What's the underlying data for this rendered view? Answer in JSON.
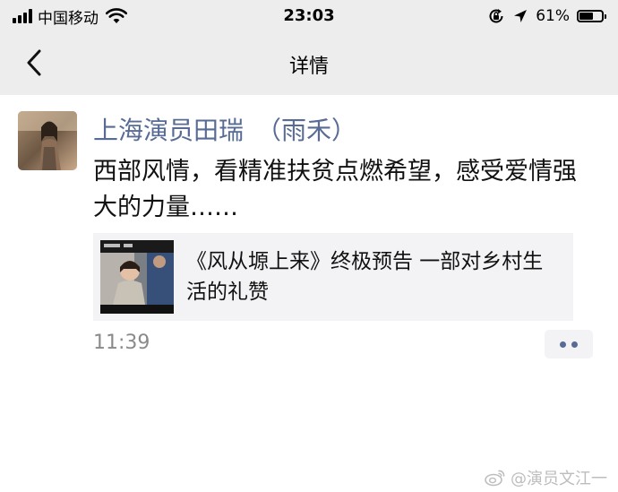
{
  "status_bar": {
    "carrier": "中国移动",
    "time": "23:03",
    "battery_text": "61%",
    "battery_level": 0.61,
    "icons": [
      "signal-icon",
      "wifi-icon",
      "rotation-lock-icon",
      "location-icon",
      "battery-icon"
    ]
  },
  "nav": {
    "back_icon": "chevron-left-icon",
    "title": "详情"
  },
  "moment": {
    "author": "上海演员田瑞　（雨禾）",
    "text": "西部风情，看精准扶贫点燃希望，感受爱情强大的力量……",
    "link": {
      "title": "《风从塬上来》终极预告 一部对乡村生活的礼赞"
    },
    "time": "11:39",
    "more_icon": "more-dots-icon"
  },
  "watermark": {
    "text": "@演员文江一",
    "icon": "weibo-icon"
  },
  "colors": {
    "bar_background": "#ededed",
    "name_link": "#576b95",
    "card_background": "#f3f3f5",
    "time_gray": "#8a8a8a"
  }
}
